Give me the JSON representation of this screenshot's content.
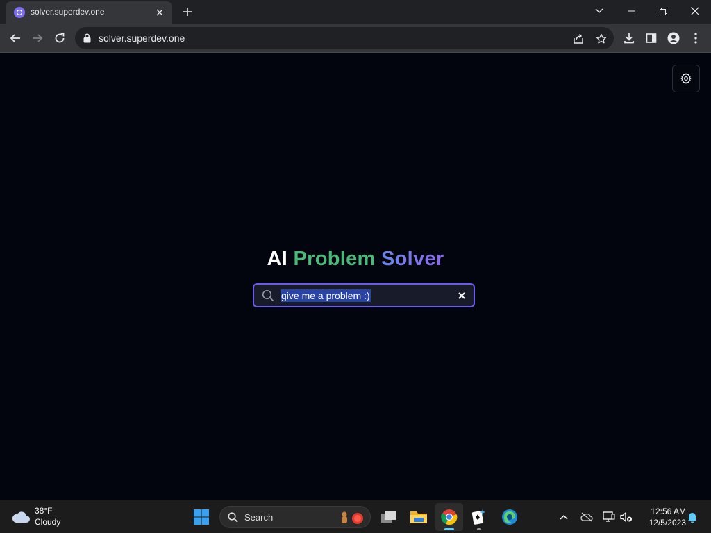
{
  "browser": {
    "tab": {
      "title": "solver.superdev.one"
    },
    "address_bar": {
      "url": "solver.superdev.one"
    }
  },
  "page": {
    "headline": {
      "word1": "AI",
      "word2": "Problem",
      "word3": "Solver"
    },
    "search": {
      "value": "give me a problem :)"
    },
    "colors": {
      "accent": "#6b5cf0",
      "green": "#4cb87a",
      "blue_violet": "#7b78e8",
      "background": "#03050e"
    }
  },
  "taskbar": {
    "weather": {
      "temp": "38°F",
      "desc": "Cloudy"
    },
    "search_label": "Search",
    "clock": {
      "time": "12:56 AM",
      "date": "12/5/2023"
    },
    "apps": [
      "start",
      "search",
      "task-view",
      "file-explorer",
      "chrome",
      "solitaire",
      "edge"
    ]
  }
}
